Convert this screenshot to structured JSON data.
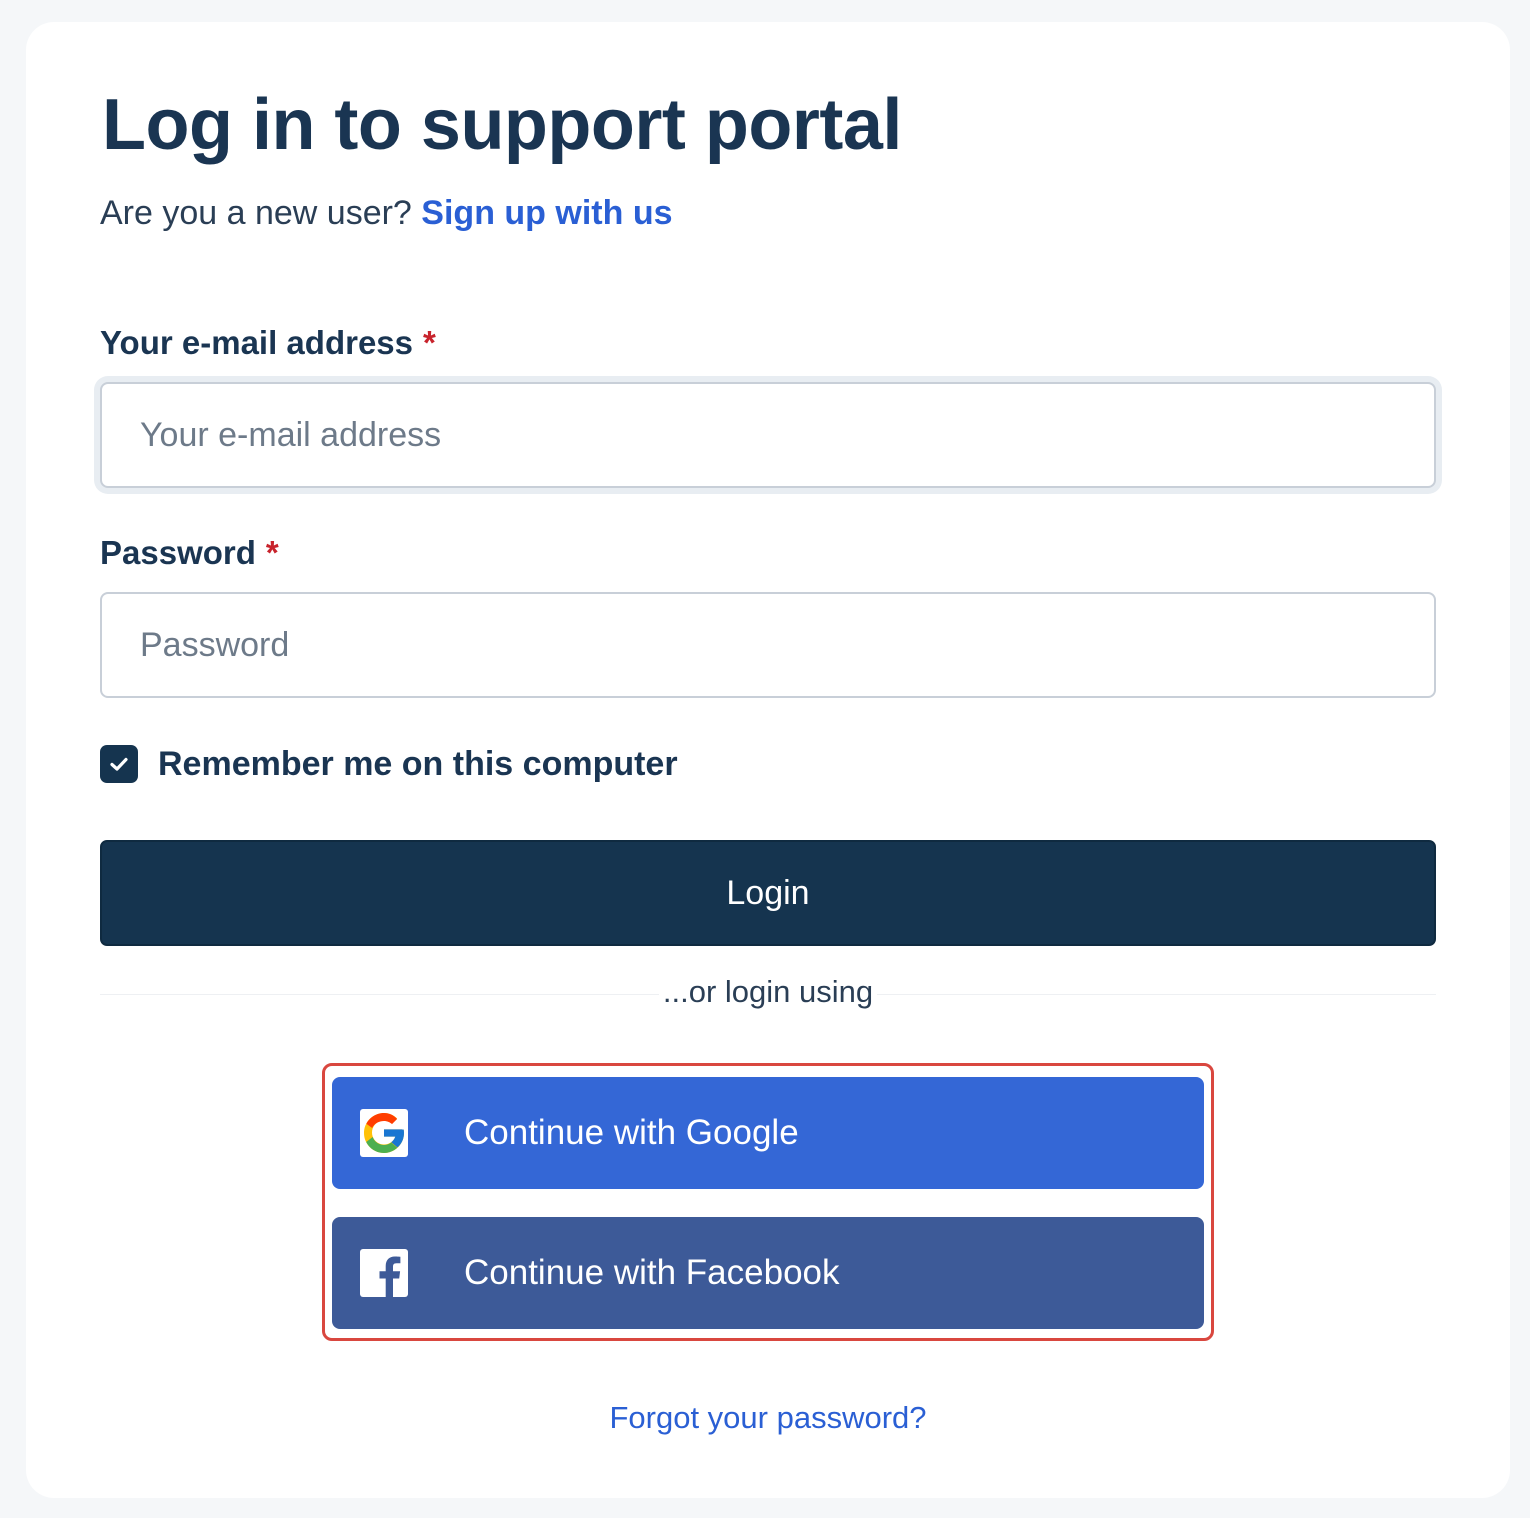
{
  "page": {
    "title": "Log in to support portal",
    "subtitle_text": "Are you a new user?",
    "signup_link": "Sign up with us"
  },
  "form": {
    "email": {
      "label": "Your e-mail address",
      "required_mark": "*",
      "placeholder": "Your e-mail address",
      "value": ""
    },
    "password": {
      "label": "Password",
      "required_mark": "*",
      "placeholder": "Password",
      "value": ""
    },
    "remember": {
      "label": "Remember me on this computer",
      "checked": true
    },
    "login_button": "Login"
  },
  "social": {
    "divider_text": "...or login using",
    "google": {
      "label": "Continue with Google",
      "icon": "google-icon"
    },
    "facebook": {
      "label": "Continue with Facebook",
      "icon": "facebook-icon"
    }
  },
  "forgot_link": "Forgot your password?",
  "colors": {
    "primary": "#15344f",
    "link": "#2a5fd4",
    "google": "#3467d6",
    "facebook": "#3d5a98",
    "required": "#c8232c",
    "highlight": "#d9473f"
  }
}
